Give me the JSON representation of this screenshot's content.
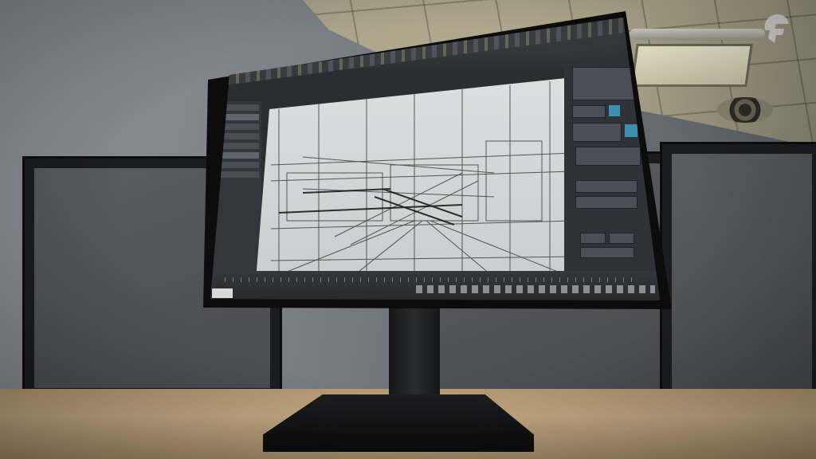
{
  "scene": {
    "description_type": "3D rendered office desk with monitor showing wireframe CAD viewport",
    "colors": {
      "screen_ui": "#2b2d30",
      "viewport_bg": "#d4d6d7",
      "accent": "#3d8fb0",
      "desk": "#b59a73",
      "monitor": "#0c0c0d"
    },
    "icons": [
      "helmet-logo-icon"
    ]
  }
}
